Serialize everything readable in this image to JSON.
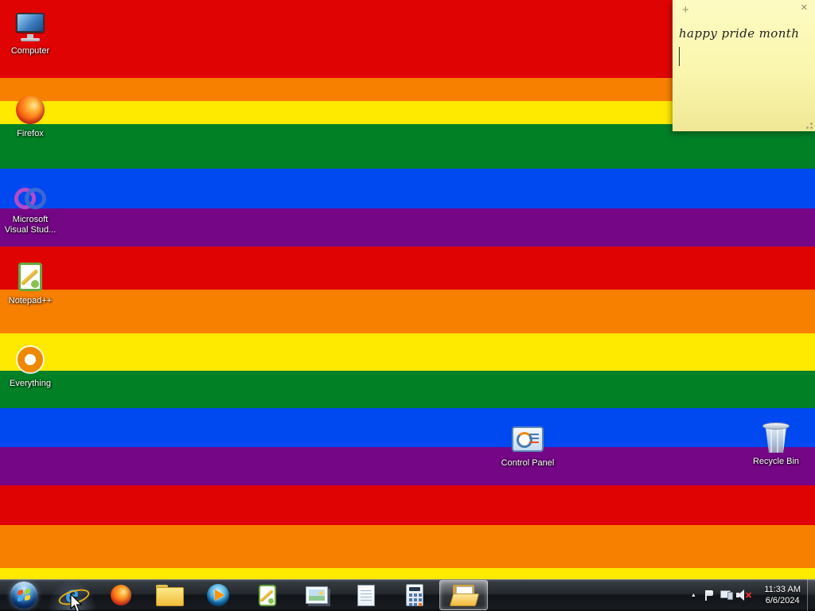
{
  "desktop": {
    "wallpaper": {
      "stripes": [
        {
          "color": "#E00303",
          "from": 0,
          "to": 98
        },
        {
          "color": "#F88000",
          "from": 98,
          "to": 127
        },
        {
          "color": "#FEE900",
          "from": 127,
          "to": 156
        },
        {
          "color": "#018026",
          "from": 156,
          "to": 212
        },
        {
          "color": "#0048F0",
          "from": 212,
          "to": 262
        },
        {
          "color": "#750787",
          "from": 262,
          "to": 310
        },
        {
          "color": "#E00303",
          "from": 310,
          "to": 364
        },
        {
          "color": "#F88000",
          "from": 364,
          "to": 419
        },
        {
          "color": "#FEE900",
          "from": 419,
          "to": 466
        },
        {
          "color": "#018026",
          "from": 466,
          "to": 513
        },
        {
          "color": "#0048F0",
          "from": 513,
          "to": 562
        },
        {
          "color": "#750787",
          "from": 562,
          "to": 610
        },
        {
          "color": "#E00303",
          "from": 610,
          "to": 660
        },
        {
          "color": "#F88000",
          "from": 660,
          "to": 714
        },
        {
          "color": "#FEE900",
          "from": 714,
          "to": 768
        }
      ]
    },
    "icons": [
      {
        "id": "computer",
        "label": "Computer"
      },
      {
        "id": "firefox",
        "label": "Firefox"
      },
      {
        "id": "visual-studio",
        "label": "Microsoft Visual Stud..."
      },
      {
        "id": "notepad-plus-plus",
        "label": "Notepad++"
      },
      {
        "id": "everything",
        "label": "Everything"
      },
      {
        "id": "control-panel",
        "label": "Control Panel"
      },
      {
        "id": "recycle-bin",
        "label": "Recycle Bin"
      }
    ]
  },
  "sticky_note": {
    "text": "happy pride month",
    "new_note_button": "+",
    "close_button": "✕"
  },
  "taskbar": {
    "pinned_icons": [
      "internet-explorer",
      "firefox",
      "windows-explorer",
      "windows-media-player",
      "notepad-plus-plus",
      "image-viewer",
      "notepad",
      "calculator"
    ],
    "active_window": "windows-explorer",
    "tray": {
      "show_hidden_icons": "▲",
      "icons": [
        "action-center-flag",
        "network",
        "volume-muted"
      ],
      "clock": {
        "time": "11:33 AM",
        "date": "6/6/2024"
      }
    }
  }
}
